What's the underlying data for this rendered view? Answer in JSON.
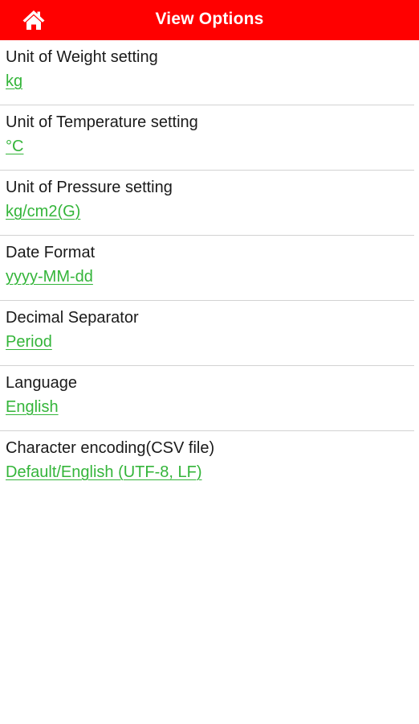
{
  "colors": {
    "header_bg": "#ff0000",
    "header_text": "#ffffff",
    "accent": "#34b53a",
    "label_text": "#1a1a1a",
    "divider": "#d2d2d2"
  },
  "header": {
    "title": "View Options",
    "home_icon": "home-icon"
  },
  "settings": [
    {
      "label": "Unit of Weight setting",
      "value": "kg"
    },
    {
      "label": "Unit of Temperature setting",
      "value": "°C"
    },
    {
      "label": "Unit of Pressure setting",
      "value": "kg/cm2(G)"
    },
    {
      "label": "Date Format",
      "value": "yyyy-MM-dd"
    },
    {
      "label": "Decimal Separator",
      "value": "Period"
    },
    {
      "label": "Language",
      "value": "English"
    },
    {
      "label": "Character encoding(CSV file)",
      "value": "Default/English (UTF-8, LF)"
    }
  ]
}
